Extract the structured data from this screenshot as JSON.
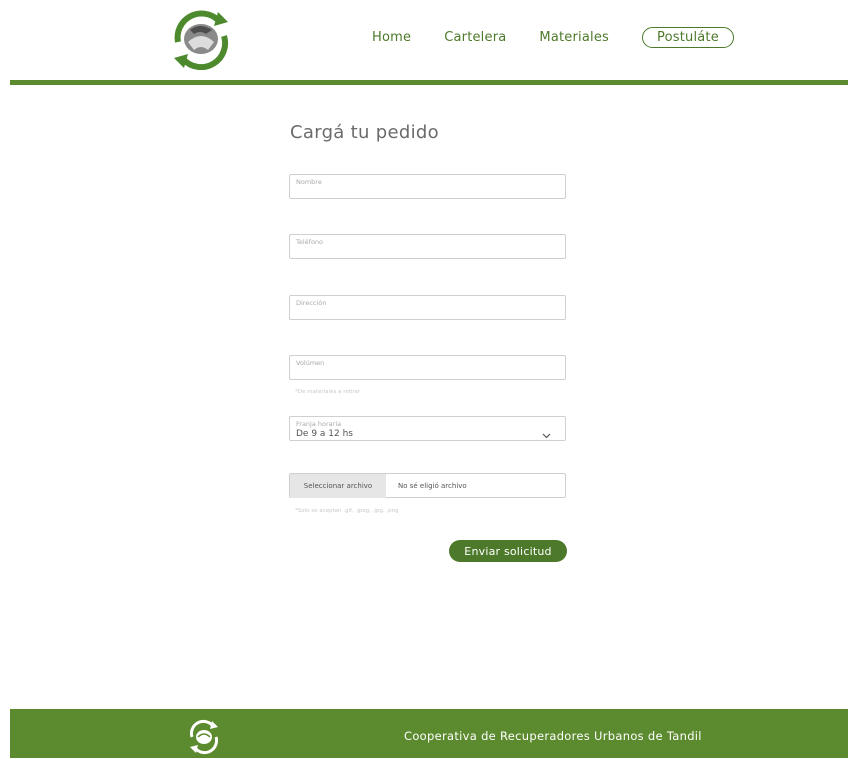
{
  "nav": {
    "items": [
      "Home",
      "Cartelera",
      "Materiales"
    ],
    "cta": "Postuláte"
  },
  "form": {
    "title": "Cargá tu pedido",
    "nombre_label": "Nombre",
    "telefono_label": "Teléfono",
    "direccion_label": "Dirección",
    "volumen_label": "Volúmen",
    "volumen_hint": "*De materiales a retirar",
    "franja_label": "Franja horaria",
    "franja_value": "De 9 a 12 hs",
    "file_button": "Seleccionar archivo",
    "file_status": "No sé eligió archivo",
    "file_hint": "*Solo se aceptan .gif, .jpeg, .jpg, .png",
    "submit": "Enviar solicitud"
  },
  "footer": {
    "text": "Cooperativa de Recuperadores Urbanos de Tandil"
  },
  "colors": {
    "brand_green": "#5c8a2e",
    "dark_green": "#4d7a2a"
  }
}
